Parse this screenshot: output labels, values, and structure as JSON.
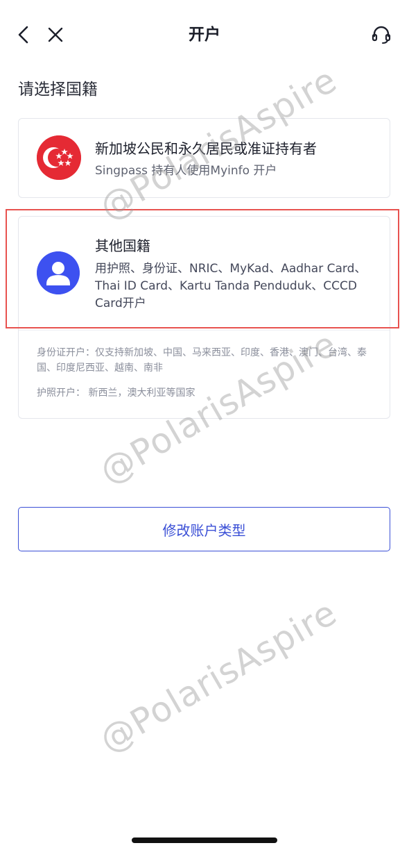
{
  "header": {
    "title": "开户"
  },
  "section": {
    "title": "请选择国籍"
  },
  "options": {
    "singapore": {
      "title": "新加坡公民和永久居民或准证持有者",
      "subtitle": "Singpass 持有人使用Myinfo 开户",
      "icon": "singapore-flag-icon"
    },
    "other": {
      "title": "其他国籍",
      "subtitle": "用护照、身份证、NRIC、MyKad、Aadhar Card、Thai ID Card、Kartu Tanda Penduduk、CCCD Card开户",
      "icon": "person-icon",
      "note_id": "身份证开户：仅支持新加坡、中国、马来西亚、印度、香港、澳门、台湾、泰国、印度尼西亚、越南、南非",
      "note_passport": "护照开户： 新西兰，澳大利亚等国家"
    }
  },
  "change_account_type": {
    "label": "修改账户类型"
  },
  "watermark": {
    "text": "@PolarisAspire"
  },
  "colors": {
    "accent": "#3a4fd6",
    "highlight": "#e8524f",
    "flag_red": "#e52a34",
    "person_blue": "#3d51f0"
  }
}
